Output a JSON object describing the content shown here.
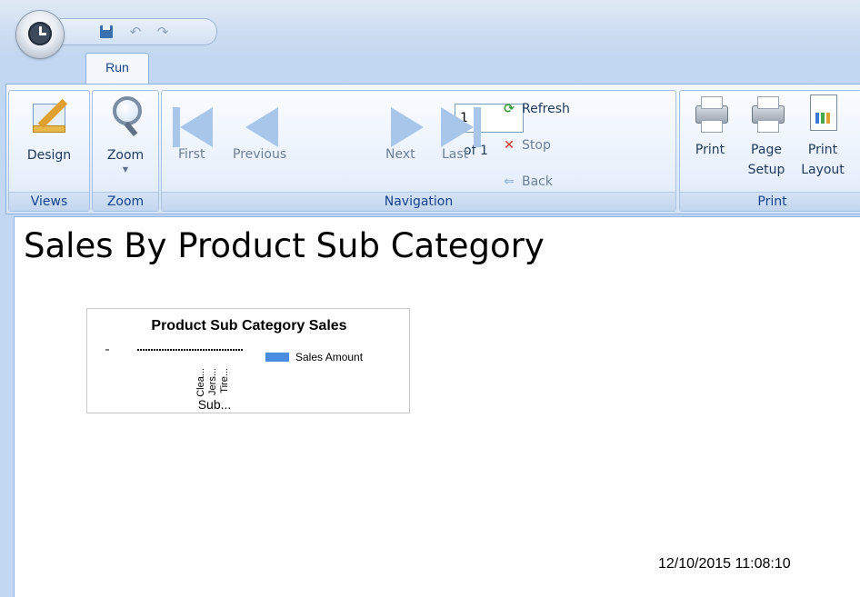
{
  "ribbon": {
    "tab": "Run",
    "views": {
      "group_label": "Views",
      "design_label": "Design"
    },
    "zoom": {
      "group_label": "Zoom",
      "zoom_label": "Zoom"
    },
    "navigation": {
      "group_label": "Navigation",
      "first_label": "First",
      "previous_label": "Previous",
      "page_value": "1",
      "of_label": "of 1",
      "next_label": "Next",
      "last_label": "Last",
      "refresh_label": "Refresh",
      "stop_label": "Stop",
      "back_label": "Back"
    },
    "print": {
      "group_label": "Print",
      "print_label": "Print",
      "page_setup_line1": "Page",
      "page_setup_line2": "Setup",
      "print_layout_line1": "Print",
      "print_layout_line2": "Layout"
    }
  },
  "icons": [
    "clock-icon",
    "save-icon",
    "undo-icon",
    "redo-icon",
    "design-icon",
    "zoom-icon",
    "first-icon",
    "previous-icon",
    "next-icon",
    "last-icon",
    "refresh-icon",
    "stop-icon",
    "back-icon",
    "print-icon",
    "page-setup-icon",
    "print-layout-icon"
  ],
  "colors": {
    "accent": "#15428b",
    "series": "#4a8de0",
    "refresh": "#3a9a3a",
    "stop": "#d03020"
  },
  "report": {
    "title": "Sales By Product Sub Category",
    "timestamp": "12/10/2015 11:08:10"
  },
  "chart_data": {
    "type": "bar",
    "title": "Product Sub Category Sales",
    "categories": [
      "Clea...",
      "Jers...",
      "Tire..."
    ],
    "series": [
      {
        "name": "Sales Amount",
        "values": []
      }
    ],
    "xlabel": "Sub...",
    "ylabel": "",
    "legend": "right"
  }
}
